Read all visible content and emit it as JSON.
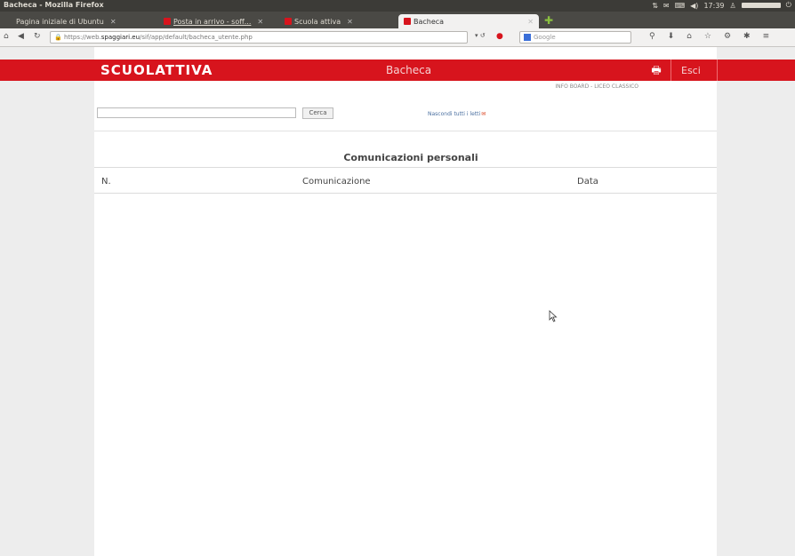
{
  "window": {
    "title": "Bacheca - Mozilla Firefox",
    "clock": "17:39"
  },
  "tabs": [
    {
      "label": "Pagina iniziale di Ubuntu",
      "active": false
    },
    {
      "label": "Posta in arrivo - soff...",
      "active": false
    },
    {
      "label": "Scuola attiva",
      "active": false
    },
    {
      "label": "Bacheca",
      "active": true
    }
  ],
  "navbar": {
    "url_prefix": "https://web.",
    "url_domain": "spaggiari.eu",
    "url_path": "/sif/app/default/bacheca_utente.php",
    "search_placeholder": "Google"
  },
  "header": {
    "logo": "SCUOLATTIVA",
    "page_title": "Bacheca",
    "logout_label": "Esci",
    "print_icon": "print-icon",
    "brand_color": "#d7141d"
  },
  "content": {
    "school_info": "INFO BOARD - LICEO CLASSICO",
    "search_value": "",
    "search_button": "Cerca",
    "new_link": "Nascondi tutti i letti",
    "section_title": "Comunicazioni personali",
    "columns": [
      "N.",
      "Comunicazione",
      "Data"
    ],
    "rows": []
  }
}
